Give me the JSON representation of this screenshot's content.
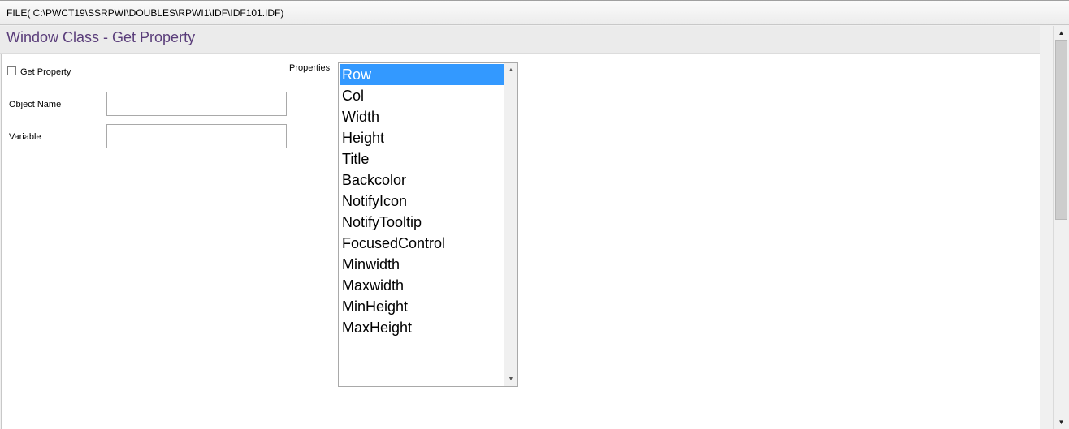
{
  "titlebar": {
    "path": "FILE( C:\\PWCT19\\SSRPWI\\DOUBLES\\RPWI1\\IDF\\IDF101.IDF)"
  },
  "header": {
    "title": "Window Class - Get Property"
  },
  "form": {
    "get_property_label": "Get Property",
    "get_property_checked": false,
    "object_name_label": "Object Name",
    "object_name_value": "",
    "variable_label": "Variable",
    "variable_value": "",
    "properties_label": "Properties"
  },
  "properties": {
    "selected": "Row",
    "items": [
      "Row",
      "Col",
      "Width",
      "Height",
      "Title",
      "Backcolor",
      "NotifyIcon",
      "NotifyTooltip",
      "FocusedControl",
      "Minwidth",
      "Maxwidth",
      "MinHeight",
      "MaxHeight"
    ]
  },
  "icons": {
    "list_up": "scroll-up-arrow-icon",
    "list_down": "scroll-down-arrow-icon",
    "page_up": "scroll-up-arrow-icon",
    "page_down": "scroll-down-arrow-icon"
  },
  "colors": {
    "selection": "#3399ff",
    "header_text": "#5a3d7a"
  }
}
